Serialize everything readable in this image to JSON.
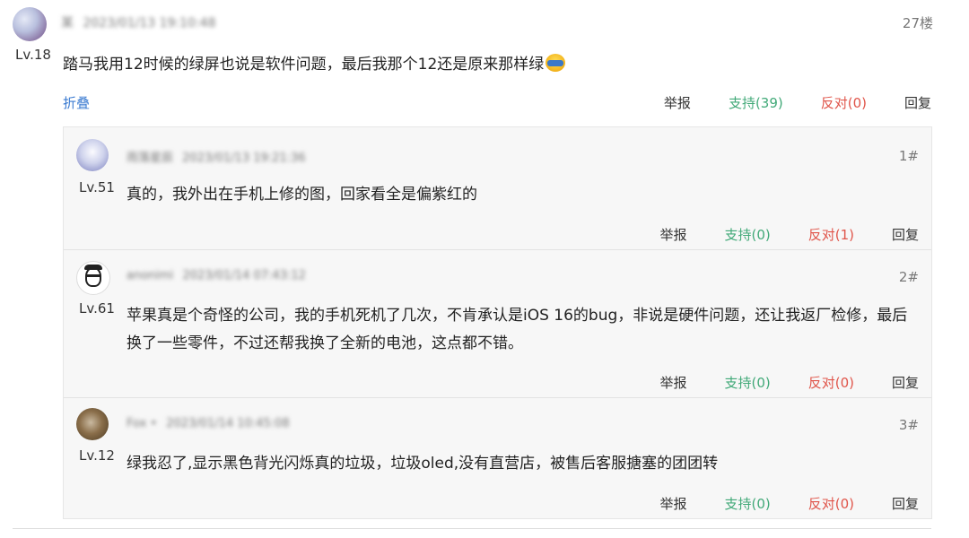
{
  "main": {
    "username": "某",
    "timestamp": "2023/01/13 19:10:48",
    "level": "Lv.18",
    "floor": "27楼",
    "content": "踏马我用12时候的绿屏也说是软件问题，最后我那个12还是原来那样绿",
    "emoji": "grimace-emoji",
    "fold_label": "折叠",
    "actions": {
      "report": "举报",
      "support": "支持(39)",
      "oppose": "反对(0)",
      "reply": "回复"
    }
  },
  "replies": [
    {
      "username": "雨落星辰",
      "timestamp": "2023/01/13 19:21:36",
      "level": "Lv.51",
      "floor": "1#",
      "content": "真的，我外出在手机上修的图，回家看全是偏紫红的",
      "actions": {
        "report": "举报",
        "support": "支持(0)",
        "oppose": "反对(1)",
        "reply": "回复"
      }
    },
    {
      "username": "anonimi",
      "timestamp": "2023/01/14 07:43:12",
      "level": "Lv.61",
      "floor": "2#",
      "content": "苹果真是个奇怪的公司，我的手机死机了几次，不肯承认是iOS 16的bug，非说是硬件问题，还让我返厂检修，最后换了一些零件，不过还帮我换了全新的电池，这点都不错。",
      "actions": {
        "report": "举报",
        "support": "支持(0)",
        "oppose": "反对(0)",
        "reply": "回复"
      }
    },
    {
      "username": "Fox •",
      "timestamp": "2023/01/14 10:45:08",
      "level": "Lv.12",
      "floor": "3#",
      "content": "绿我忍了,显示黑色背光闪烁真的垃圾，垃圾oled,没有直营店，被售后客服搪塞的团团转",
      "actions": {
        "report": "举报",
        "support": "支持(0)",
        "oppose": "反对(0)",
        "reply": "回复"
      }
    }
  ],
  "colors": {
    "support": "#41a978",
    "oppose": "#e0554a",
    "fold": "#3b7bd1"
  }
}
